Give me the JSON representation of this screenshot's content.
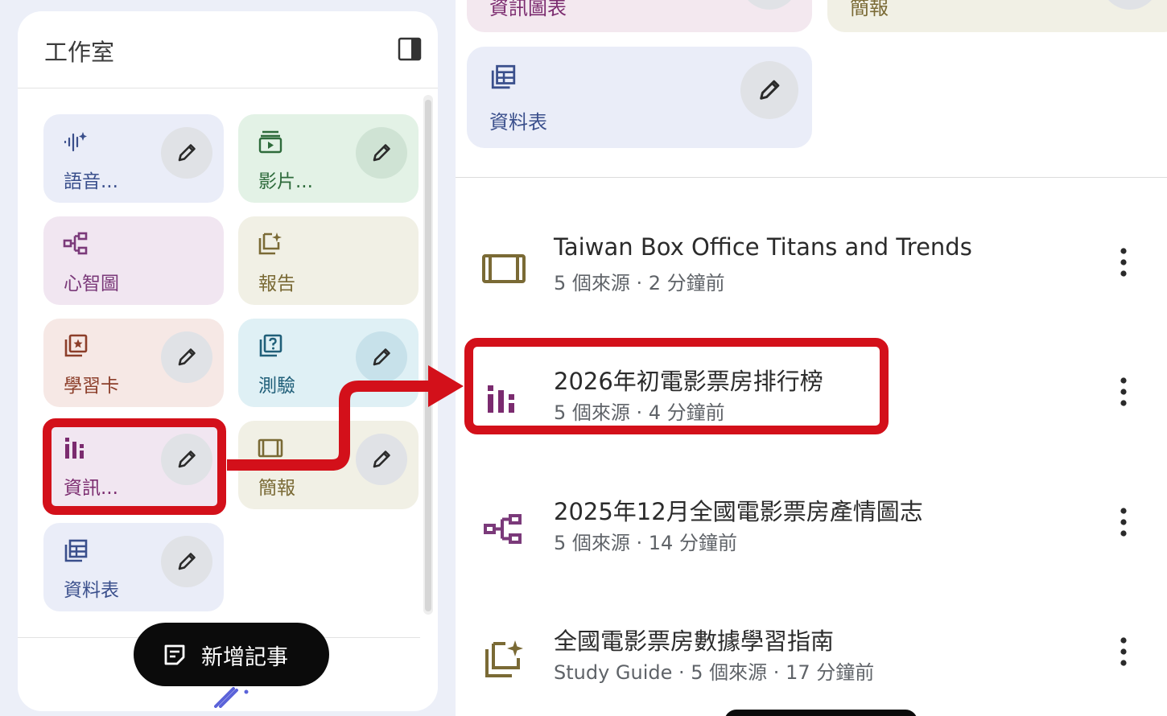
{
  "studio": {
    "title": "工作室",
    "cards": [
      {
        "label": "語音...",
        "icon": "audio-sparkle-icon",
        "bg": "#eaedf8",
        "color": "#3a4f8c"
      },
      {
        "label": "影片...",
        "icon": "video-icon",
        "bg": "#e3f2e6",
        "color": "#2e6b3b"
      },
      {
        "label": "心智圖",
        "icon": "mind-map-icon",
        "bg": "#f1e6f1",
        "color": "#7b3a7a"
      },
      {
        "label": "報告",
        "icon": "report-icon",
        "bg": "#f1f0e5",
        "color": "#7a6a35"
      },
      {
        "label": "學習卡",
        "icon": "flashcard-icon",
        "bg": "#f6e8e5",
        "color": "#8c3e2a"
      },
      {
        "label": "測驗",
        "icon": "quiz-icon",
        "bg": "#dff0f5",
        "color": "#205f79"
      },
      {
        "label": "資訊...",
        "icon": "infographic-icon",
        "bg": "#f1e6f1",
        "color": "#7b2b6f"
      },
      {
        "label": "簡報",
        "icon": "slides-icon",
        "bg": "#f1f0e5",
        "color": "#7a6a35"
      },
      {
        "label": "資料表",
        "icon": "data-table-icon",
        "bg": "#eaedf8",
        "color": "#3a4f8c"
      }
    ],
    "add_note_label": "新增記事"
  },
  "main": {
    "top_cards": [
      {
        "label": "資訊圖表",
        "bg": "#f3e8ef"
      },
      {
        "label": "簡報",
        "bg": "#f1f0e5"
      },
      {
        "label": "資料表",
        "bg": "#eaedf8",
        "color": "#3a4f8c"
      }
    ],
    "notes": [
      {
        "title": "Taiwan Box Office Titans and Trends",
        "meta": "5 個來源 · 2 分鐘前",
        "icon": "slides-icon",
        "color": "#7a6a35"
      },
      {
        "title": "2026年初電影票房排行榜",
        "meta": "5 個來源 · 4 分鐘前",
        "icon": "infographic-icon",
        "color": "#7b2b6f"
      },
      {
        "title": "2025年12月全國電影票房產情圖志",
        "meta": "5 個來源 · 14 分鐘前",
        "icon": "mind-map-icon",
        "color": "#7b3a7a"
      },
      {
        "title": "全國電影票房數據學習指南",
        "meta": "Study Guide · 5 個來源 · 17 分鐘前",
        "icon": "report-icon",
        "color": "#7a6a35"
      }
    ]
  },
  "colors": {
    "highlight": "#d3101a",
    "edit_button": "#e0e2e6"
  }
}
